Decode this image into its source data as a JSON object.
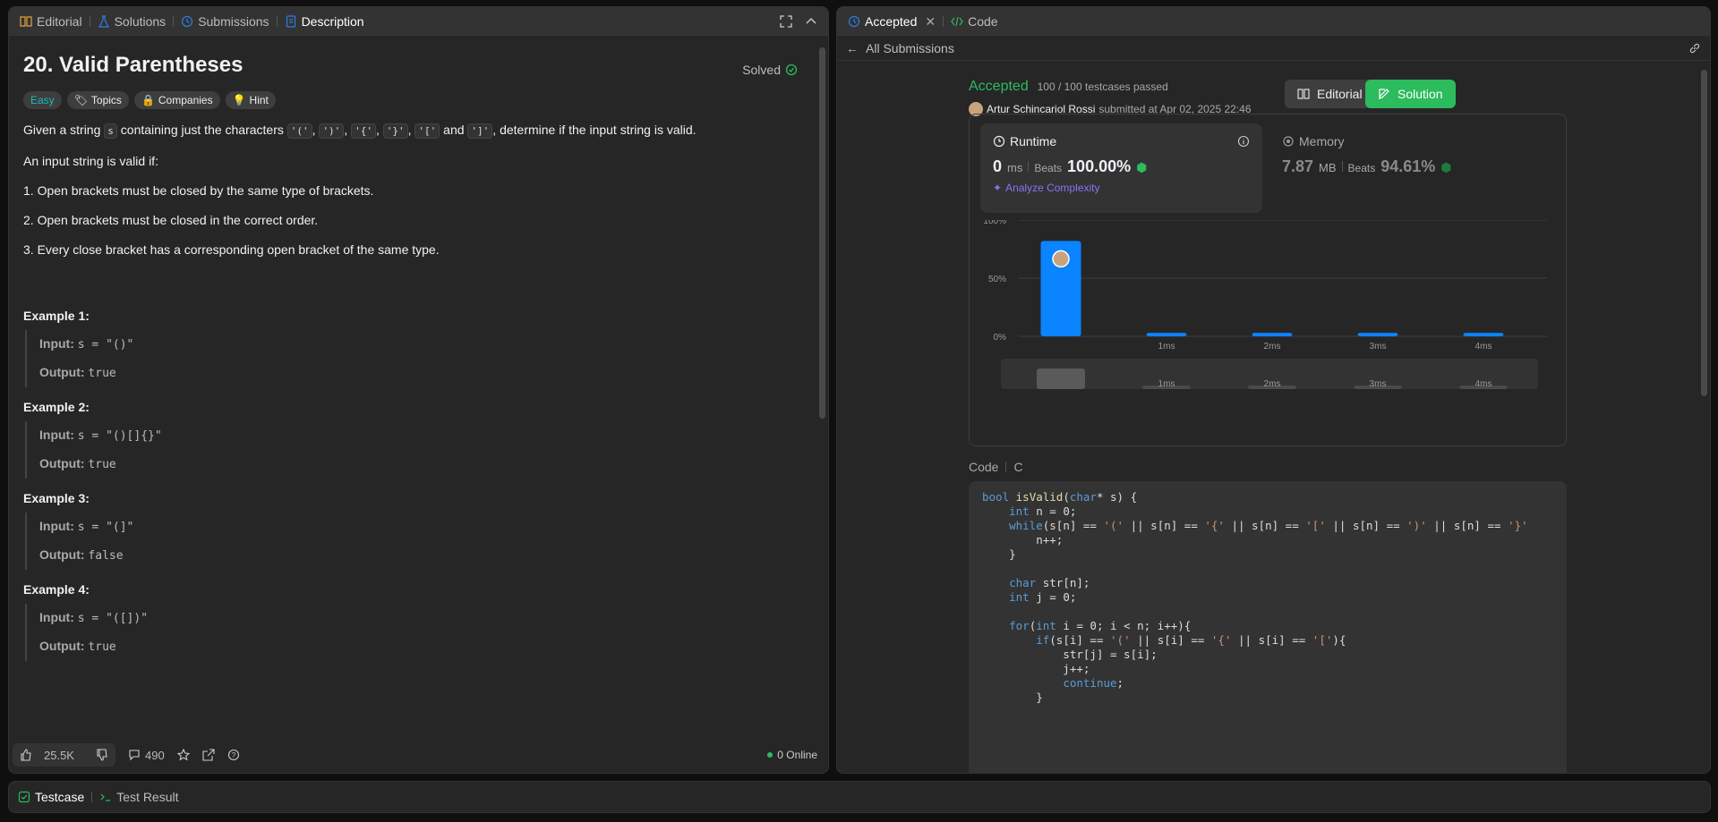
{
  "left_tabs": [
    {
      "label": "Editorial",
      "icon": "book-icon",
      "color": "#e6a23c"
    },
    {
      "label": "Solutions",
      "icon": "flask-icon",
      "color": "#2f7de1"
    },
    {
      "label": "Submissions",
      "icon": "history-icon",
      "color": "#2f7de1"
    },
    {
      "label": "Description",
      "icon": "document-icon",
      "color": "#2f7de1"
    }
  ],
  "problem": {
    "title": "20. Valid Parentheses",
    "solved": "Solved",
    "chips": [
      "Easy",
      "Topics",
      "Companies",
      "Hint"
    ],
    "intro_a": "Given a string",
    "intro_s": "s",
    "intro_b": "containing just the characters",
    "chars": [
      "'('",
      "')'",
      "'{'",
      "'}'",
      "'['",
      "']'"
    ],
    "intro_and": "and",
    "intro_c": ", determine if the input string is valid.",
    "valid_if": "An input string is valid if:",
    "rules": [
      "1. Open brackets must be closed by the same type of brackets.",
      "2. Open brackets must be closed in the correct order.",
      "3. Every close bracket has a corresponding open bracket of the same type."
    ],
    "input_label": "Input:",
    "output_label": "Output:",
    "examples": [
      {
        "title": "Example 1:",
        "input": "s = \"()\"",
        "output": "true"
      },
      {
        "title": "Example 2:",
        "input": "s = \"()[]{}\"",
        "output": "true"
      },
      {
        "title": "Example 3:",
        "input": "s = \"(]\"",
        "output": "false"
      },
      {
        "title": "Example 4:",
        "input": "s = \"([])\"",
        "output": "true"
      }
    ]
  },
  "footer": {
    "likes": "25.5K",
    "comments": "490",
    "online": "0 Online"
  },
  "right_tabs": [
    {
      "label": "Accepted",
      "icon": "history-icon"
    },
    {
      "label": "Code",
      "icon": "code-icon"
    }
  ],
  "sub_nav": "All Submissions",
  "submission": {
    "status": "Accepted",
    "passed": "100 / 100 testcases passed",
    "author": "Artur Schincariol Rossi",
    "submitted": "submitted at Apr 02, 2025 22:46",
    "editorial_btn": "Editorial",
    "solution_btn": "Solution"
  },
  "runtime": {
    "label": "Runtime",
    "value": "0",
    "unit": "ms",
    "beats_label": "Beats",
    "beats": "100.00%",
    "analyze": "Analyze Complexity"
  },
  "memory": {
    "label": "Memory",
    "value": "7.87",
    "unit": "MB",
    "beats_label": "Beats",
    "beats": "94.61%"
  },
  "chart_data": {
    "type": "bar",
    "categories": [
      "0ms",
      "1ms",
      "2ms",
      "3ms",
      "4ms"
    ],
    "x_tick_labels": [
      "",
      "1ms",
      "2ms",
      "3ms",
      "4ms"
    ],
    "values": [
      82,
      3,
      3,
      3,
      3
    ],
    "y_tick_labels": [
      "100%",
      "50%",
      "0%"
    ],
    "ylim": [
      0,
      100
    ],
    "highlight_index": 0,
    "bar_color": "#0a84ff"
  },
  "code": {
    "label": "Code",
    "lang": "C",
    "lines": [
      "bool isValid(char* s) {",
      "    int n = 0;",
      "    while(s[n] == '(' || s[n] == '{' || s[n] == '[' || s[n] == ')' || s[n] == '}'",
      "        n++;",
      "    }",
      "",
      "    char str[n];",
      "    int j = 0;",
      "",
      "    for(int i = 0; i < n; i++){",
      "        if(s[i] == '(' || s[i] == '{' || s[i] == '['){",
      "            str[j] = s[i];",
      "            j++;",
      "            continue;",
      "        }"
    ]
  },
  "bottom_tabs": [
    {
      "label": "Testcase",
      "icon": "checkbox-icon"
    },
    {
      "label": "Test Result",
      "icon": "terminal-icon"
    }
  ]
}
